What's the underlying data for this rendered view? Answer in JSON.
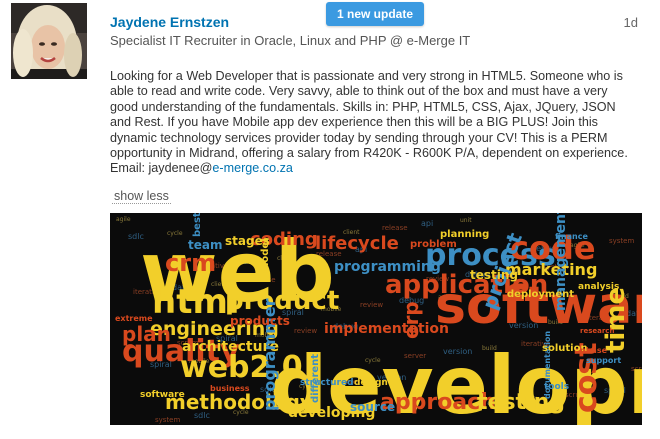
{
  "post": {
    "author_name": "Jaydene Ernstzen",
    "author_headline": "Specialist IT Recruiter in Oracle, Linux and PHP @ e-Merge IT",
    "timestamp": "1d",
    "update_pill": "1 new update",
    "body_text": "Looking for a Web Developer that is passionate and very strong in HTML5. Someone who is able to read and write code. Very savvy, able to think out of the box and must have a very good understanding of the fundamentals. Skills in: PHP, HTML5, CSS, Ajax, JQuery, JSON and Rest. If you have Mobile app dev experience then this will be a BIG PLUS! Join this dynamic technology services provider today by sending through your CV! This is a PERM opportunity in Midrand, offering a salary from R420K - R600K P/A, dependent on experience. Email: jaydenee@",
    "email_link": "e-merge.co.za",
    "show_less": "show less"
  },
  "word_cloud": {
    "words": [
      {
        "text": "web",
        "color": "#f2cf2a"
      },
      {
        "text": "development",
        "color": "#f2cf2a"
      },
      {
        "text": "software",
        "color": "#d9491e"
      },
      {
        "text": "html",
        "color": "#f2cf2a"
      },
      {
        "text": "product",
        "color": "#f2cf2a"
      },
      {
        "text": "process",
        "color": "#3d8fc4"
      },
      {
        "text": "application",
        "color": "#d9491e"
      },
      {
        "text": "code",
        "color": "#d9491e"
      },
      {
        "text": "engineering",
        "color": "#f2cf2a"
      },
      {
        "text": "quality",
        "color": "#d9491e"
      },
      {
        "text": "web2.0",
        "color": "#f2cf2a"
      },
      {
        "text": "methodology",
        "color": "#f2cf2a"
      },
      {
        "text": "approach",
        "color": "#d9491e"
      },
      {
        "text": "testing",
        "color": "#f2cf2a"
      },
      {
        "text": "programming",
        "color": "#3d8fc4"
      },
      {
        "text": "lifecycle",
        "color": "#d9491e"
      },
      {
        "text": "coding",
        "color": "#d9491e"
      },
      {
        "text": "crm",
        "color": "#d9491e"
      },
      {
        "text": "plan",
        "color": "#d9491e"
      },
      {
        "text": "architecture",
        "color": "#f2cf2a"
      },
      {
        "text": "marketing",
        "color": "#f2cf2a"
      },
      {
        "text": "management",
        "color": "#3d8fc4"
      },
      {
        "text": "implementation",
        "color": "#d9491e"
      },
      {
        "text": "programmer",
        "color": "#3d8fc4"
      },
      {
        "text": "cost",
        "color": "#d9491e"
      },
      {
        "text": "time",
        "color": "#f2cf2a"
      },
      {
        "text": "project",
        "color": "#3d8fc4"
      },
      {
        "text": "erp",
        "color": "#d9491e"
      },
      {
        "text": "deployment",
        "color": "#f2cf2a"
      },
      {
        "text": "developing",
        "color": "#f2cf2a"
      },
      {
        "text": "source",
        "color": "#3d8fc4"
      },
      {
        "text": "stages",
        "color": "#f2cf2a"
      },
      {
        "text": "products",
        "color": "#d9491e"
      },
      {
        "text": "team",
        "color": "#3d8fc4"
      },
      {
        "text": "problem",
        "color": "#d9491e"
      },
      {
        "text": "planning",
        "color": "#f2cf2a"
      },
      {
        "text": "testing",
        "color": "#f2cf2a"
      },
      {
        "text": "business",
        "color": "#d9491e"
      },
      {
        "text": "documentation",
        "color": "#3d8fc4"
      },
      {
        "text": "extreme",
        "color": "#d9491e"
      },
      {
        "text": "different",
        "color": "#3d8fc4"
      },
      {
        "text": "model",
        "color": "#f2cf2a"
      },
      {
        "text": "software",
        "color": "#f2cf2a"
      },
      {
        "text": "tools",
        "color": "#3d8fc4"
      },
      {
        "text": "design",
        "color": "#f2cf2a"
      },
      {
        "text": "finance",
        "color": "#3d8fc4"
      },
      {
        "text": "solution",
        "color": "#f2cf2a"
      },
      {
        "text": "structured",
        "color": "#3d8fc4"
      },
      {
        "text": "analysis",
        "color": "#f2cf2a"
      },
      {
        "text": "research",
        "color": "#d9491e"
      },
      {
        "text": "support",
        "color": "#3d8fc4"
      },
      {
        "text": "phase",
        "color": "#d9491e"
      },
      {
        "text": "best",
        "color": "#3d8fc4"
      }
    ]
  }
}
